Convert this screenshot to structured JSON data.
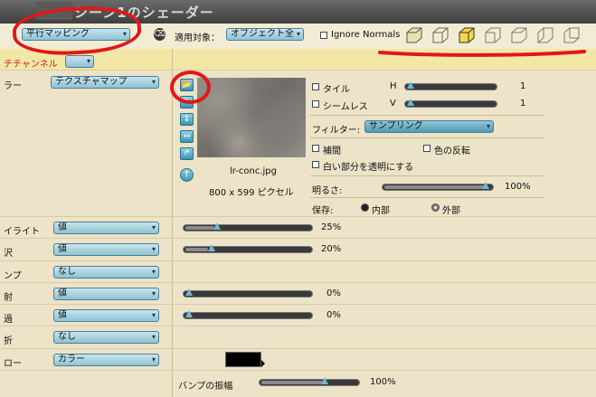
{
  "window": {
    "title": "シーン1のシェーダー"
  },
  "toolbar": {
    "mapping": "平行マッピング",
    "target_label": "適用対象：",
    "target_value": "オブジェクト全",
    "ignore_normals": "Ignore Normals"
  },
  "channel": {
    "label": "チチャンネル"
  },
  "color_row": {
    "label": "ラー",
    "type": "テクスチャマップ"
  },
  "texture": {
    "filename": "lr-conc.jpg",
    "size": "800 x 599 ピクセル",
    "tile": "タイル",
    "seamless": "シームレス",
    "h_label": "H",
    "v_label": "V",
    "h_value": "1",
    "v_value": "1",
    "filter_label": "フィルター:",
    "filter_value": "サンプリング",
    "interpolate": "補間",
    "invert": "色の反転",
    "white_transparent": "白い部分を透明にする",
    "brightness_label": "明るさ:",
    "brightness_value": "100%",
    "save_label": "保存:",
    "save_internal": "内部",
    "save_external": "外部"
  },
  "rows": [
    {
      "label": "イライト",
      "mode": "値",
      "value": "25%",
      "level": 0.25
    },
    {
      "label": "沢",
      "mode": "値",
      "value": "20%",
      "level": 0.2
    },
    {
      "label": "ンプ",
      "mode": "なし"
    },
    {
      "label": "射",
      "mode": "値",
      "value": "0%",
      "level": 0
    },
    {
      "label": "過",
      "mode": "値",
      "value": "0%",
      "level": 0
    },
    {
      "label": "折",
      "mode": "なし"
    },
    {
      "label": "ロー",
      "mode": "カラー"
    }
  ],
  "bump": {
    "label": "バンプの振幅",
    "value": "100%",
    "level": 1.0
  },
  "colors": {
    "accent": "#e01818",
    "select": "#8fc2d3",
    "swatch": "#000000"
  }
}
